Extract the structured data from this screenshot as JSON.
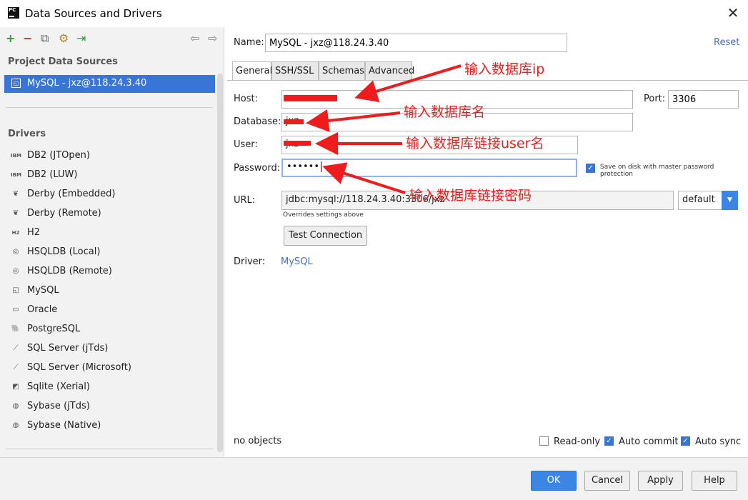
{
  "window": {
    "title": "Data Sources and Drivers",
    "close": "✕",
    "app_icon": "PC"
  },
  "toolbar": {
    "add": "+",
    "remove": "−",
    "copy": "⧉",
    "settings": "⚙",
    "import": "⇥",
    "back": "⇦",
    "forward": "⇨"
  },
  "left": {
    "project_title": "Project Data Sources",
    "selected_source": "MySQL - jxz@118.24.3.40",
    "drivers_title": "Drivers",
    "drivers": [
      {
        "label": "DB2 (JTOpen)",
        "icon": "IBM"
      },
      {
        "label": "DB2 (LUW)",
        "icon": "IBM"
      },
      {
        "label": "Derby (Embedded)",
        "icon": "❦"
      },
      {
        "label": "Derby (Remote)",
        "icon": "❦"
      },
      {
        "label": "H2",
        "icon": "H2"
      },
      {
        "label": "HSQLDB (Local)",
        "icon": "◎"
      },
      {
        "label": "HSQLDB (Remote)",
        "icon": "◎"
      },
      {
        "label": "MySQL",
        "icon": "◱"
      },
      {
        "label": "Oracle",
        "icon": "▭"
      },
      {
        "label": "PostgreSQL",
        "icon": "🐘"
      },
      {
        "label": "SQL Server (jTds)",
        "icon": "⟋"
      },
      {
        "label": "SQL Server (Microsoft)",
        "icon": "⟋"
      },
      {
        "label": "Sqlite (Xerial)",
        "icon": "◩"
      },
      {
        "label": "Sybase (jTds)",
        "icon": "◍"
      },
      {
        "label": "Sybase (Native)",
        "icon": "◍"
      }
    ]
  },
  "form": {
    "name_label": "Name:",
    "name_value": "MySQL - jxz@118.24.3.40",
    "reset": "Reset",
    "tabs": [
      "General",
      "SSH/SSL",
      "Schemas",
      "Advanced"
    ],
    "host_label": "Host:",
    "port_label": "Port:",
    "port_value": "3306",
    "database_label": "Database:",
    "database_value": "jxz",
    "user_label": "User:",
    "user_value": "jxz",
    "password_label": "Password:",
    "password_value": "••••••",
    "save_on_disk": "Save on disk with master password protection",
    "url_label": "URL:",
    "url_value": "jdbc:mysql://118.24.3.40:3306/jxz",
    "url_mode": "default",
    "url_hint": "Overrides settings above",
    "test_connection": "Test Connection",
    "driver_label": "Driver:",
    "driver_value": "MySQL",
    "status": "no objects",
    "read_only": "Read-only",
    "auto_commit": "Auto commit",
    "auto_sync": "Auto sync"
  },
  "annotations": {
    "ip": "输入数据库ip",
    "db_name": "输入数据库名",
    "user": "输入数据库链接user名",
    "password": "输入数据库链接密码"
  },
  "buttons": {
    "ok": "OK",
    "cancel": "Cancel",
    "apply": "Apply",
    "help": "Help"
  },
  "colors": {
    "accent": "#3875d7",
    "annotation": "#ee1c1c",
    "link": "#4a6fb5"
  }
}
